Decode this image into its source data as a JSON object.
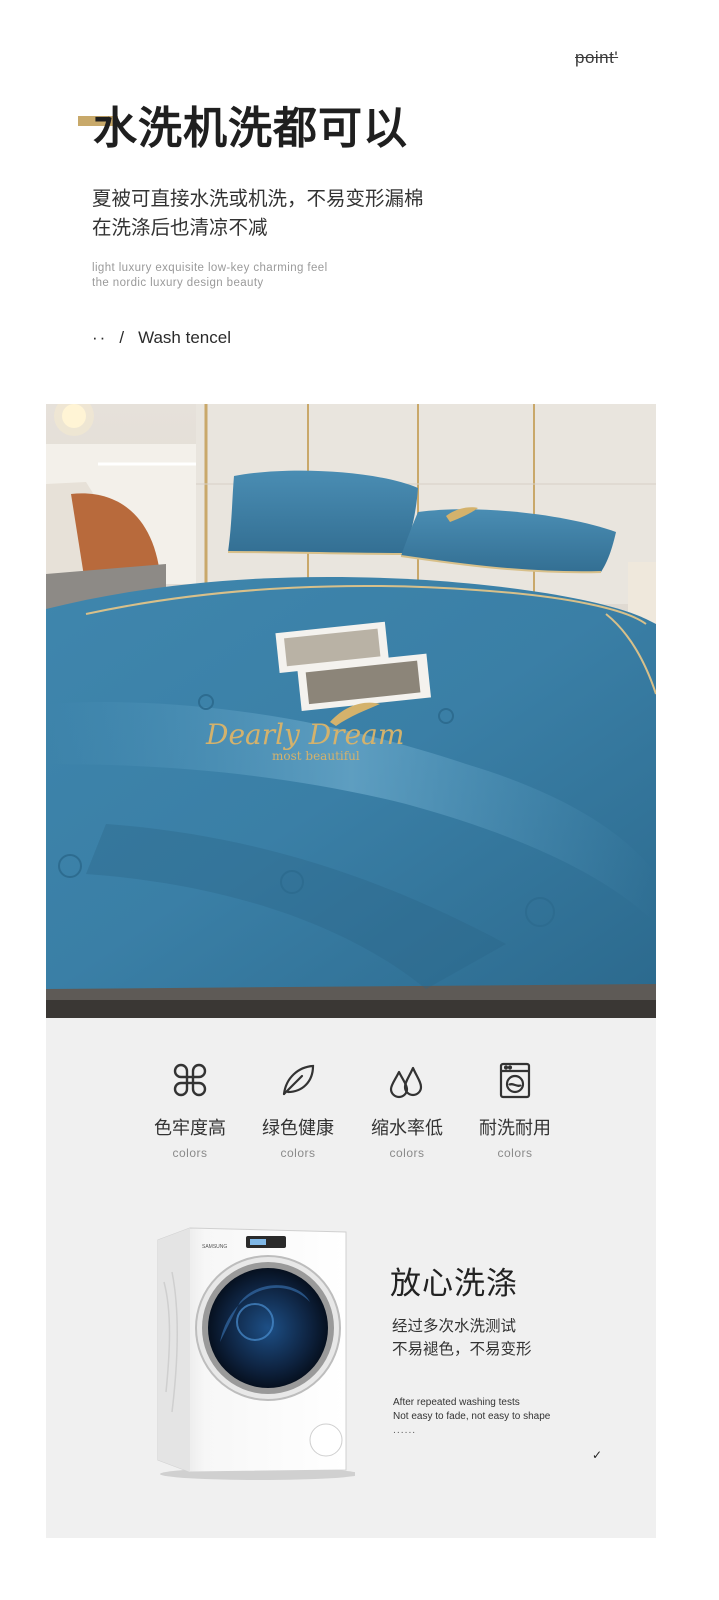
{
  "header": {
    "point_tag": "point'",
    "title": "水洗机洗都可以",
    "desc_lines": [
      "夏被可直接水洗或机洗，不易变形漏棉",
      "在洗涤后也清凉不减"
    ],
    "en_lines": [
      "light luxury exquisite low-key charming feel",
      "the nordic luxury design beauty"
    ],
    "crumb_dots": "··",
    "crumb_slash": "/",
    "crumb_label": "Wash tencel"
  },
  "photo": {
    "embroidery_script": "Dearly Dream",
    "embroidery_sub": "most  beautiful",
    "colors": {
      "duvet": "#3a7fa6",
      "accent": "#c8a96a"
    }
  },
  "features": [
    {
      "icon": "clover-icon",
      "cn": "色牢度高",
      "en": "colors"
    },
    {
      "icon": "leaf-icon",
      "cn": "绿色健康",
      "en": "colors"
    },
    {
      "icon": "water-drops-icon",
      "cn": "缩水率低",
      "en": "colors"
    },
    {
      "icon": "washing-machine-icon",
      "cn": "耐洗耐用",
      "en": "colors"
    }
  ],
  "care": {
    "title": "放心洗涤",
    "desc_lines": [
      "经过多次水洗测试",
      "不易褪色，不易变形"
    ],
    "en_lines": [
      "After repeated washing tests",
      "Not easy to fade, not easy to shape"
    ],
    "dots": "......",
    "tick": "✓"
  }
}
